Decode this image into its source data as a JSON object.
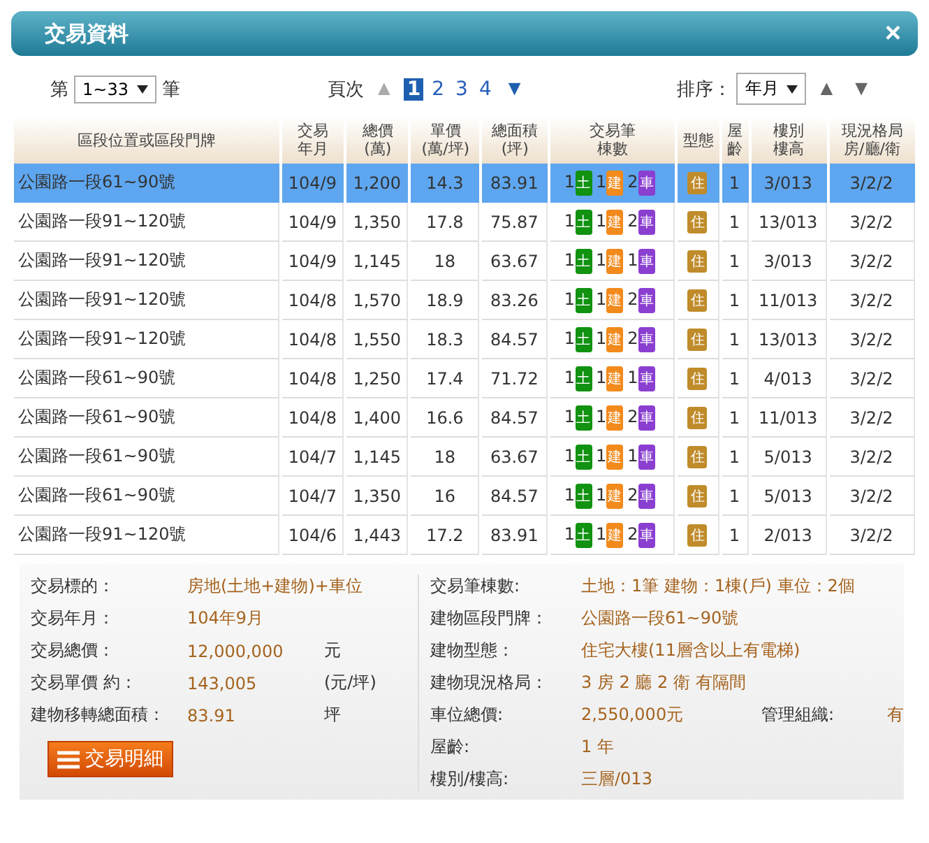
{
  "window": {
    "title": "交易資料",
    "close": "×"
  },
  "range": {
    "prefix": "第",
    "value": "1~33",
    "suffix": "筆"
  },
  "pager": {
    "label": "頁次",
    "prev": "▲",
    "pages": [
      {
        "label": "1",
        "selected": true
      },
      {
        "label": "2",
        "selected": false
      },
      {
        "label": "3",
        "selected": false
      },
      {
        "label": "4",
        "selected": false
      }
    ],
    "next": "▼"
  },
  "sort": {
    "label": "排序：",
    "value": "年月",
    "asc": "▲",
    "desc": "▼"
  },
  "table": {
    "columns": [
      "區段位置或區段門牌",
      "交易年月",
      "總價(萬)",
      "單價(萬/坪)",
      "總面積(坪)",
      "交易筆棟數",
      "型態",
      "屋齡",
      "樓別樓高",
      "現況格局房/廳/衛"
    ],
    "rows": [
      {
        "selected": true,
        "address": "公園路一段61~90號",
        "month": "104/9",
        "total": "1,200",
        "unit": "14.3",
        "area": "83.91",
        "units": [
          {
            "count": "1",
            "label": "土",
            "color": "#119211"
          },
          {
            "count": "1",
            "label": "建",
            "color": "#f28a1c"
          },
          {
            "count": "2",
            "label": "車",
            "color": "#8a3fd1"
          }
        ],
        "type": "住",
        "age": "1",
        "floor": "3/013",
        "layout": "3/2/2"
      },
      {
        "selected": false,
        "address": "公園路一段91~120號",
        "month": "104/9",
        "total": "1,350",
        "unit": "17.8",
        "area": "75.87",
        "units": [
          {
            "count": "1",
            "label": "土",
            "color": "#119211"
          },
          {
            "count": "1",
            "label": "建",
            "color": "#f28a1c"
          },
          {
            "count": "2",
            "label": "車",
            "color": "#8a3fd1"
          }
        ],
        "type": "住",
        "age": "1",
        "floor": "13/013",
        "layout": "3/2/2"
      },
      {
        "selected": false,
        "address": "公園路一段91~120號",
        "month": "104/9",
        "total": "1,145",
        "unit": "18",
        "area": "63.67",
        "units": [
          {
            "count": "1",
            "label": "土",
            "color": "#119211"
          },
          {
            "count": "1",
            "label": "建",
            "color": "#f28a1c"
          },
          {
            "count": "1",
            "label": "車",
            "color": "#8a3fd1"
          }
        ],
        "type": "住",
        "age": "1",
        "floor": "3/013",
        "layout": "3/2/2"
      },
      {
        "selected": false,
        "address": "公園路一段91~120號",
        "month": "104/8",
        "total": "1,570",
        "unit": "18.9",
        "area": "83.26",
        "units": [
          {
            "count": "1",
            "label": "土",
            "color": "#119211"
          },
          {
            "count": "1",
            "label": "建",
            "color": "#f28a1c"
          },
          {
            "count": "2",
            "label": "車",
            "color": "#8a3fd1"
          }
        ],
        "type": "住",
        "age": "1",
        "floor": "11/013",
        "layout": "3/2/2"
      },
      {
        "selected": false,
        "address": "公園路一段91~120號",
        "month": "104/8",
        "total": "1,550",
        "unit": "18.3",
        "area": "84.57",
        "units": [
          {
            "count": "1",
            "label": "土",
            "color": "#119211"
          },
          {
            "count": "1",
            "label": "建",
            "color": "#f28a1c"
          },
          {
            "count": "2",
            "label": "車",
            "color": "#8a3fd1"
          }
        ],
        "type": "住",
        "age": "1",
        "floor": "13/013",
        "layout": "3/2/2"
      },
      {
        "selected": false,
        "address": "公園路一段61~90號",
        "month": "104/8",
        "total": "1,250",
        "unit": "17.4",
        "area": "71.72",
        "units": [
          {
            "count": "1",
            "label": "土",
            "color": "#119211"
          },
          {
            "count": "1",
            "label": "建",
            "color": "#f28a1c"
          },
          {
            "count": "1",
            "label": "車",
            "color": "#8a3fd1"
          }
        ],
        "type": "住",
        "age": "1",
        "floor": "4/013",
        "layout": "3/2/2"
      },
      {
        "selected": false,
        "address": "公園路一段61~90號",
        "month": "104/8",
        "total": "1,400",
        "unit": "16.6",
        "area": "84.57",
        "units": [
          {
            "count": "1",
            "label": "土",
            "color": "#119211"
          },
          {
            "count": "1",
            "label": "建",
            "color": "#f28a1c"
          },
          {
            "count": "2",
            "label": "車",
            "color": "#8a3fd1"
          }
        ],
        "type": "住",
        "age": "1",
        "floor": "11/013",
        "layout": "3/2/2"
      },
      {
        "selected": false,
        "address": "公園路一段61~90號",
        "month": "104/7",
        "total": "1,145",
        "unit": "18",
        "area": "63.67",
        "units": [
          {
            "count": "1",
            "label": "土",
            "color": "#119211"
          },
          {
            "count": "1",
            "label": "建",
            "color": "#f28a1c"
          },
          {
            "count": "1",
            "label": "車",
            "color": "#8a3fd1"
          }
        ],
        "type": "住",
        "age": "1",
        "floor": "5/013",
        "layout": "3/2/2"
      },
      {
        "selected": false,
        "address": "公園路一段61~90號",
        "month": "104/7",
        "total": "1,350",
        "unit": "16",
        "area": "84.57",
        "units": [
          {
            "count": "1",
            "label": "土",
            "color": "#119211"
          },
          {
            "count": "1",
            "label": "建",
            "color": "#f28a1c"
          },
          {
            "count": "2",
            "label": "車",
            "color": "#8a3fd1"
          }
        ],
        "type": "住",
        "age": "1",
        "floor": "5/013",
        "layout": "3/2/2"
      },
      {
        "selected": false,
        "address": "公園路一段91~120號",
        "month": "104/6",
        "total": "1,443",
        "unit": "17.2",
        "area": "83.91",
        "units": [
          {
            "count": "1",
            "label": "土",
            "color": "#119211"
          },
          {
            "count": "1",
            "label": "建",
            "color": "#f28a1c"
          },
          {
            "count": "2",
            "label": "車",
            "color": "#8a3fd1"
          }
        ],
        "type": "住",
        "age": "1",
        "floor": "2/013",
        "layout": "3/2/2"
      }
    ]
  },
  "details": {
    "left": [
      {
        "label": "交易標的：",
        "value": "房地(土地+建物)+車位"
      },
      {
        "label": "交易年月：",
        "value": "104年9月"
      },
      {
        "label": "交易總價：",
        "value": "12,000,000",
        "unit": "元"
      },
      {
        "label": "交易單價 約：",
        "value": "143,005",
        "unit": "(元/坪)"
      },
      {
        "label": "建物移轉總面積：",
        "value": "83.91",
        "unit": "坪"
      }
    ],
    "button": "交易明細",
    "right": [
      {
        "label": "交易筆棟數:",
        "value": "土地：1筆 建物：1棟(戶) 車位：2個"
      },
      {
        "label": "建物區段門牌：",
        "value": "公園路一段61~90號"
      },
      {
        "label": "建物型態：",
        "value": "住宅大樓(11層含以上有電梯)"
      },
      {
        "label": "建物現況格局：",
        "value": "3 房 2 廳 2 衛 有隔間"
      },
      {
        "label": "車位總價:",
        "value": "2,550,000元",
        "extra_label": "管理組織:",
        "extra_value": "有"
      },
      {
        "label": "屋齡:",
        "value": "1 年"
      },
      {
        "label": "樓別/樓高:",
        "value": "三層/013"
      }
    ]
  }
}
